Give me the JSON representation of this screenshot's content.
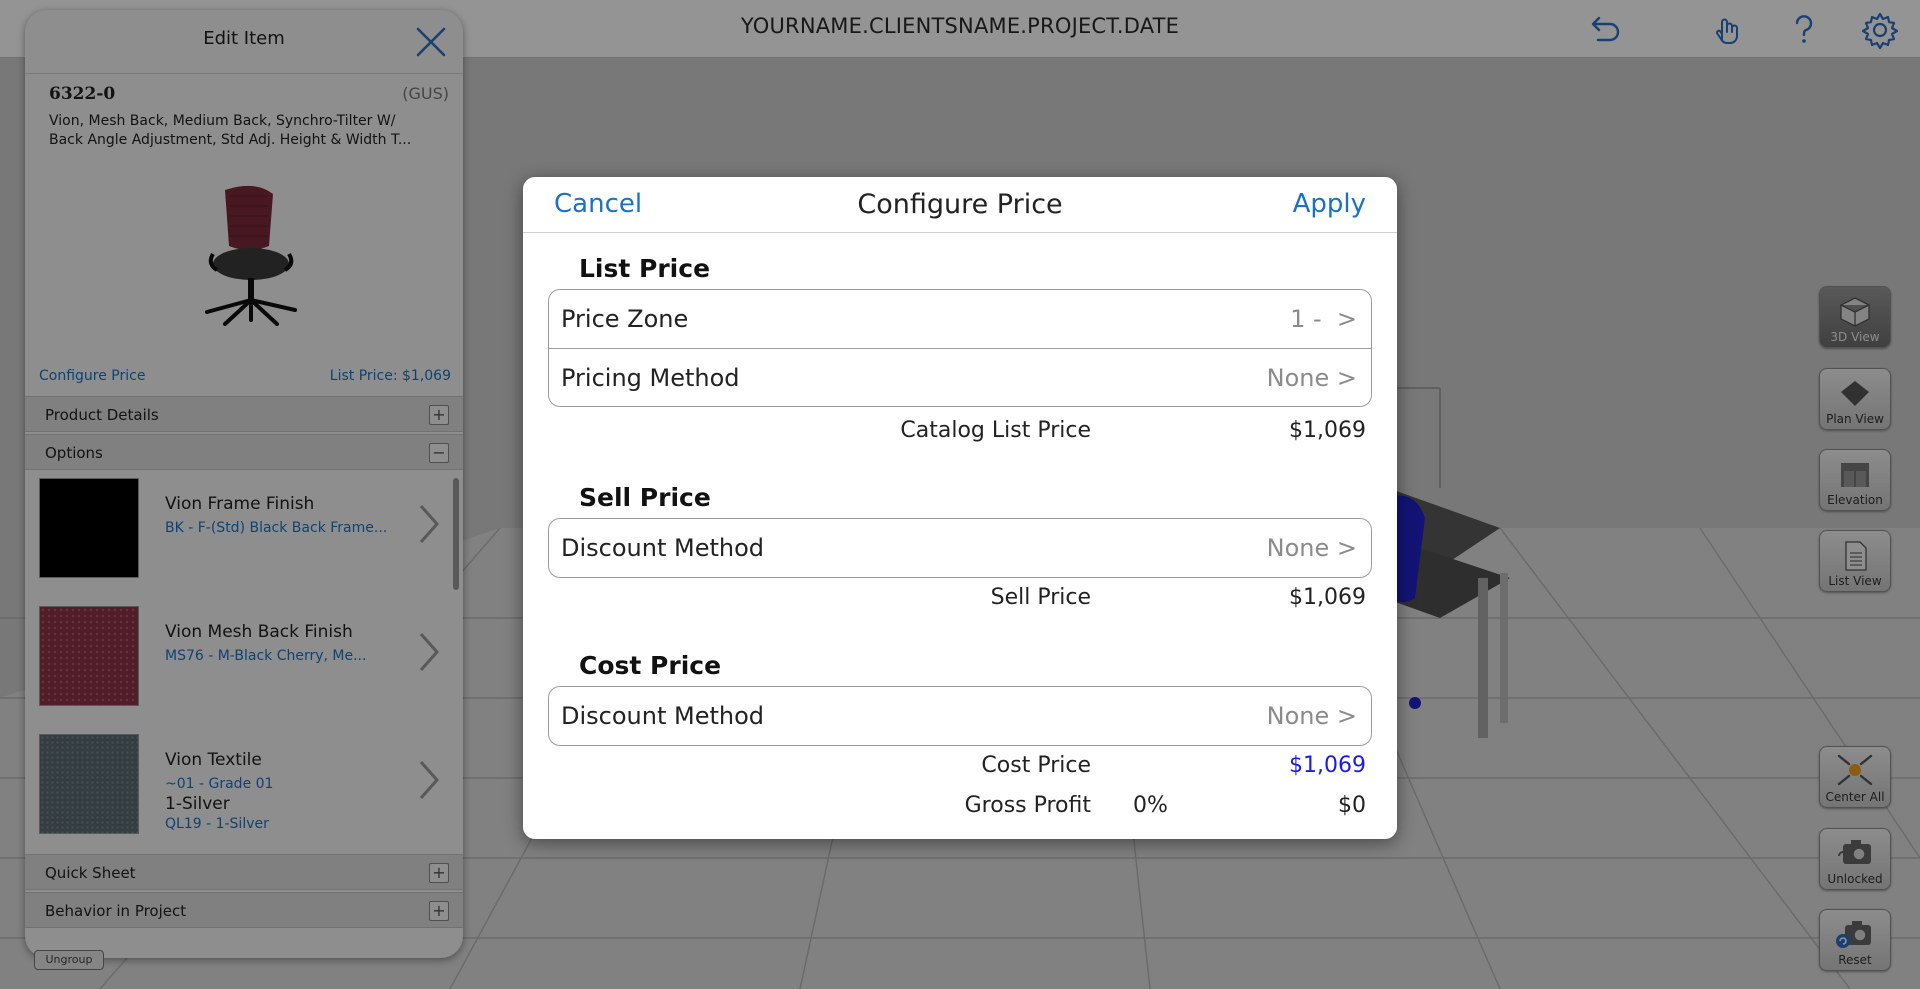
{
  "topbar": {
    "project_title": "YOURNAME.CLIENTSNAME.PROJECT.DATE"
  },
  "colors": {
    "accent_blue": "#1a72c6",
    "cost_price_blue": "#1a1aee",
    "top_icons": "#2e6fc4"
  },
  "right_toolbar": {
    "view_3d": "3D View",
    "plan_view": "Plan View",
    "elevation": "Elevation",
    "list_view": "List View",
    "center_all": "Center All",
    "unlocked": "Unlocked",
    "reset": "Reset"
  },
  "edit_item": {
    "title": "Edit Item",
    "item_code": "6322-0",
    "vendor": "(GUS)",
    "desc_line1": "Vion, Mesh Back, Medium Back, Synchro-Tilter W/",
    "desc_line2": "Back Angle Adjustment, Std Adj. Height & Width T...",
    "configure_price_link": "Configure Price",
    "list_price": "List Price: $1,069",
    "sections": {
      "product_details": "Product Details",
      "options": "Options",
      "quick_sheet": "Quick Sheet",
      "behavior_in_project": "Behavior in Project"
    },
    "options": [
      {
        "name": "Vion Frame Finish",
        "value": "BK - F-(Std) Black Back Frame..."
      },
      {
        "name": "Vion Mesh Back Finish",
        "value": "MS76 - M-Black Cherry, Me..."
      },
      {
        "name": "Vion Textile",
        "value": "~01 - Grade 01",
        "extra": "1-Silver",
        "extra_value": "QL19 - 1-Silver"
      }
    ],
    "ungroup": "Ungroup"
  },
  "configure_price": {
    "cancel": "Cancel",
    "title": "Configure Price",
    "apply": "Apply",
    "list_price": {
      "heading": "List Price",
      "price_zone_label": "Price Zone",
      "price_zone_value": "1 -  >",
      "pricing_method_label": "Pricing Method",
      "pricing_method_value": "None >",
      "catalog_list_price_label": "Catalog List Price",
      "catalog_list_price_value": "$1,069"
    },
    "sell_price": {
      "heading": "Sell Price",
      "discount_method_label": "Discount Method",
      "discount_method_value": "None >",
      "sell_price_label": "Sell Price",
      "sell_price_value": "$1,069"
    },
    "cost_price": {
      "heading": "Cost Price",
      "discount_method_label": "Discount Method",
      "discount_method_value": "None >",
      "cost_price_label": "Cost Price",
      "cost_price_value": "$1,069",
      "gross_profit_label": "Gross Profit",
      "gross_profit_pct": "0%",
      "gross_profit_value": "$0"
    }
  }
}
